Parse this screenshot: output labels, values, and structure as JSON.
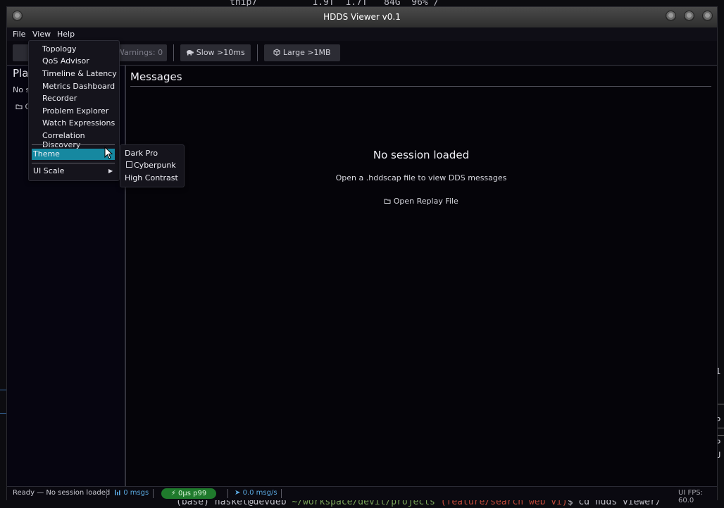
{
  "terminal": {
    "top_line": "thip7          1.9T  1.7T   84G  96% /",
    "bottom_prompt": "(base) haskel@devdeb",
    "bottom_path": "~/workspace/devit/projects",
    "bottom_branch": "(feature/search web vi)",
    "bottom_cmd": "$ cd hdds viewer/",
    "right_chars": [
      "1",
      "P",
      "P",
      "U"
    ]
  },
  "window": {
    "title": "HDDS Viewer v0.1"
  },
  "menubar": {
    "file": "File",
    "view": "View",
    "help": "Help"
  },
  "toolbar": {
    "warnings": "Warnings: 0",
    "slow": "Slow >10ms",
    "slow_icon": "turtle-icon",
    "large": "Large >1MB",
    "large_icon": "package-icon"
  },
  "left_panel": {
    "title": "Pla",
    "subtitle": "No s",
    "open_button": "C"
  },
  "main": {
    "title": "Messages",
    "empty_title": "No session loaded",
    "empty_subtitle": "Open a .hddscap file to view DDS messages",
    "open_replay": "Open Replay File"
  },
  "statusbar": {
    "ready": "Ready — No session loaded",
    "msgs": "0 msgs",
    "latency": "0µs p99",
    "rate": "0.0 msg/s",
    "fps": "UI FPS: 60.0"
  },
  "view_menu": {
    "items": [
      "Topology",
      "QoS Advisor",
      "Timeline & Latency",
      "Metrics Dashboard",
      "Recorder",
      "Problem Explorer",
      "Watch Expressions",
      "Correlation Discovery"
    ],
    "theme": "Theme",
    "ui_scale": "UI Scale"
  },
  "theme_menu": {
    "items": [
      "Dark Pro",
      "Cyberpunk",
      "High Contrast"
    ],
    "checkbox_item": "Cyberpunk"
  },
  "colors": {
    "highlight": "#1688a0",
    "latency_pill": "#1f7a2c",
    "accent_blue": "#5aa8e0",
    "window_bg": "#050409"
  }
}
